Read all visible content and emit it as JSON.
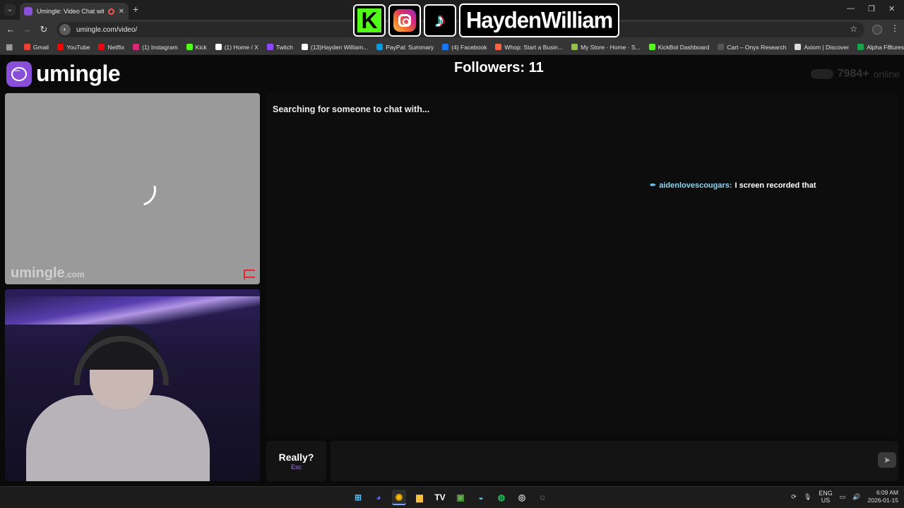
{
  "browser": {
    "tab_title": "Umingle: Video Chat with S",
    "new_tab": "+",
    "url": "umingle.com/video/",
    "bookmarks": [
      {
        "label": "Gmail",
        "color": "#ea4335"
      },
      {
        "label": "YouTube",
        "color": "#ff0000"
      },
      {
        "label": "Netflix",
        "color": "#e50914"
      },
      {
        "label": "(1) Instagram",
        "color": "#d62976"
      },
      {
        "label": "Kick",
        "color": "#53fc18"
      },
      {
        "label": "(1) Home / X",
        "color": "#ffffff"
      },
      {
        "label": "Twitch",
        "color": "#9146ff"
      },
      {
        "label": "(13)Hayden William...",
        "color": "#ffffff"
      },
      {
        "label": "PayPal: Summary",
        "color": "#009cde"
      },
      {
        "label": "(4) Facebook",
        "color": "#1877f2"
      },
      {
        "label": "Whop: Start a Busin...",
        "color": "#ff6243"
      },
      {
        "label": "My Store · Home · S...",
        "color": "#95bf47"
      },
      {
        "label": "KickBot Dashboard",
        "color": "#53fc18"
      },
      {
        "label": "Cart – Onyx Research",
        "color": "#555555"
      },
      {
        "label": "Axiom | Discover",
        "color": "#dddddd"
      },
      {
        "label": "Alpha Futures",
        "color": "#16a34a"
      }
    ]
  },
  "overlay": {
    "kick_letter": "K",
    "tiktok_glyph": "♪",
    "streamer_name": "HaydenWilliam"
  },
  "site": {
    "logo_text": "umingle",
    "followers": "Followers: 11",
    "online_count": "7984+",
    "online_label": "online",
    "watermark": "umingle",
    "watermark_suffix": ".com"
  },
  "chat": {
    "status": "Searching for someone to chat with...",
    "message_user": "aidenlovescougars:",
    "message_text": "I screen recorded that",
    "esc_label": "Really?",
    "esc_key": "Esc",
    "input_placeholder": "",
    "send_icon": "➤"
  },
  "taskbar": {
    "apps": [
      {
        "name": "windows-start-icon",
        "glyph": "⊞",
        "color": "#4cc2ff"
      },
      {
        "name": "discord-icon",
        "glyph": "◕",
        "color": "#5865f2"
      },
      {
        "name": "chrome-icon",
        "glyph": "◉",
        "color": "#fbbc05"
      },
      {
        "name": "file-explorer-icon",
        "glyph": "▆",
        "color": "#f8c03e"
      },
      {
        "name": "tradingview-icon",
        "glyph": "TV",
        "color": "#ffffff"
      },
      {
        "name": "minecraft-icon",
        "glyph": "▣",
        "color": "#62b04a"
      },
      {
        "name": "steam-icon",
        "glyph": "◒",
        "color": "#66c0f4"
      },
      {
        "name": "spotify-icon",
        "glyph": "◍",
        "color": "#1db954"
      },
      {
        "name": "obs-icon",
        "glyph": "◎",
        "color": "#dddddd"
      },
      {
        "name": "app-icon",
        "glyph": "◌",
        "color": "#dddddd"
      }
    ],
    "lang_top": "ENG",
    "lang_bottom": "US",
    "time": "6:09 AM",
    "date": "2026-01-15"
  }
}
